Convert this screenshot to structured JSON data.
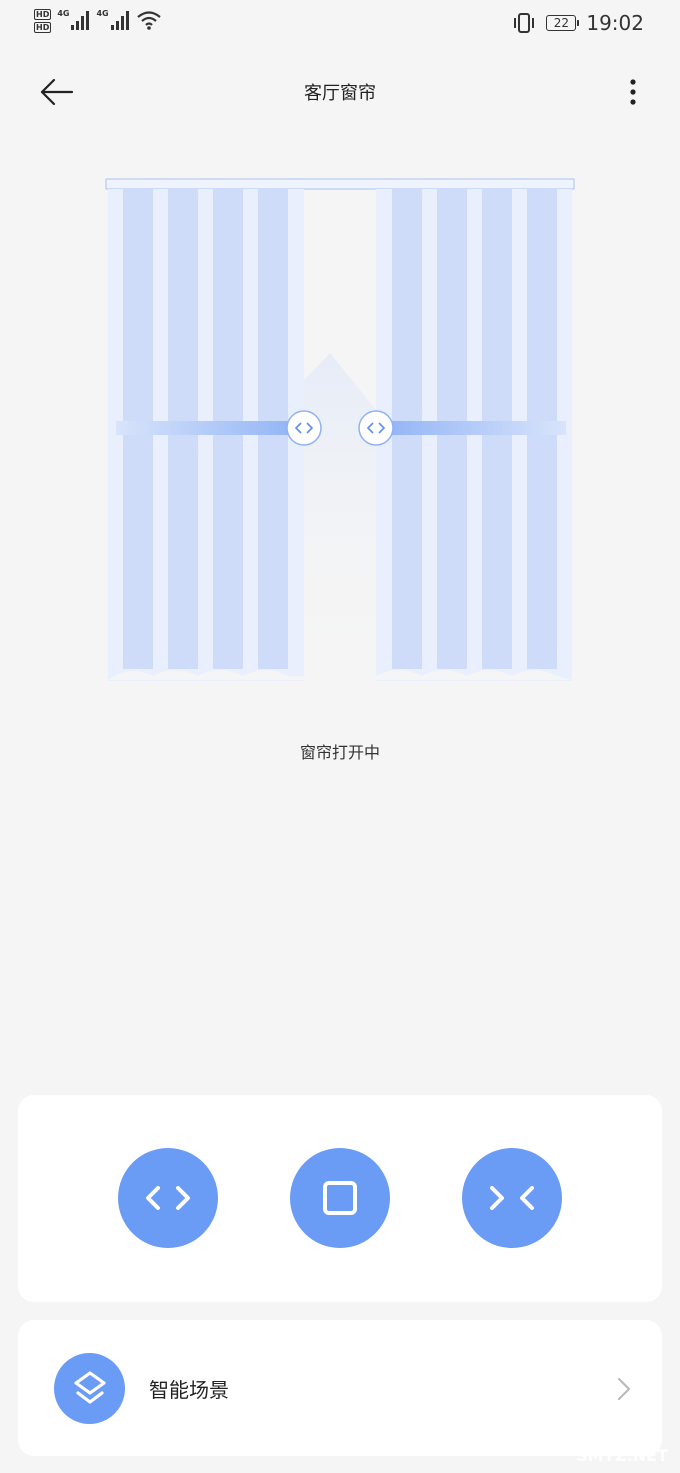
{
  "status_bar": {
    "hd_label": "HD",
    "network_1": "4G",
    "network_2": "4G",
    "battery_level": "22",
    "time": "19:02",
    "icons": [
      "signal-icon",
      "wifi-icon",
      "vibrate-icon",
      "battery-icon"
    ]
  },
  "header": {
    "title": "客厅窗帘",
    "back_icon": "arrow-left-icon",
    "more_icon": "more-vertical-icon"
  },
  "curtain": {
    "status_text": "窗帘打开中",
    "handle_icon": "code-icon"
  },
  "controls": {
    "buttons": [
      {
        "icon": "open-curtain-icon"
      },
      {
        "icon": "stop-icon"
      },
      {
        "icon": "close-curtain-icon"
      }
    ]
  },
  "scene": {
    "label": "智能场景",
    "icon": "layers-icon"
  },
  "watermark": "SMYZ.NET",
  "colors": {
    "accent": "#6a9cf5",
    "curtain": "#d6e3fb",
    "background": "#f5f5f5",
    "card": "#ffffff"
  }
}
